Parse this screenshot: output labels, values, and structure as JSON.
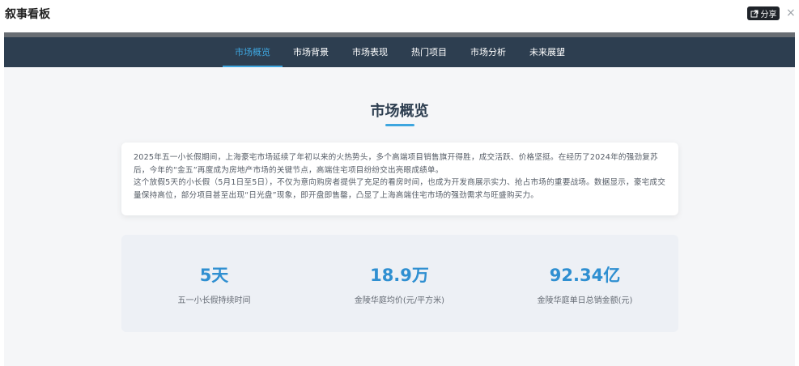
{
  "app": {
    "title": "叙事看板",
    "share_label": "分享",
    "close_symbol": "×"
  },
  "nav": {
    "items": [
      "市场概览",
      "市场背景",
      "市场表现",
      "热门项目",
      "市场分析",
      "未来展望"
    ],
    "active_index": 0
  },
  "section": {
    "title": "市场概览"
  },
  "intro": {
    "paragraph1": "2025年五一小长假期间，上海豪宅市场延续了年初以来的火热势头，多个高端项目销售旗开得胜，成交活跃、价格坚挺。在经历了2024年的强劲复苏后，今年的“金五”再度成为房地产市场的关键节点，高端住宅项目纷纷交出亮眼成绩单。",
    "paragraph2": "这个放假5天的小长假（5月1日至5日），不仅为意向购房者提供了充足的看房时间，也成为开发商展示实力、抢占市场的重要战场。数据显示，豪宅成交量保持高位，部分项目甚至出现“日光盘”现象，即开盘即售罄，凸显了上海高端住宅市场的强劲需求与旺盛购买力。"
  },
  "stats": [
    {
      "value": "5天",
      "label": "五一小长假持续时间"
    },
    {
      "value": "18.9万",
      "label": "金陵华庭均价(元/平方米)"
    },
    {
      "value": "92.34亿",
      "label": "金陵华庭单日总销金额(元)"
    }
  ],
  "colors": {
    "nav_bg": "#2d3e50",
    "accent": "#3ea6df",
    "stat_value": "#2f8fd1"
  }
}
